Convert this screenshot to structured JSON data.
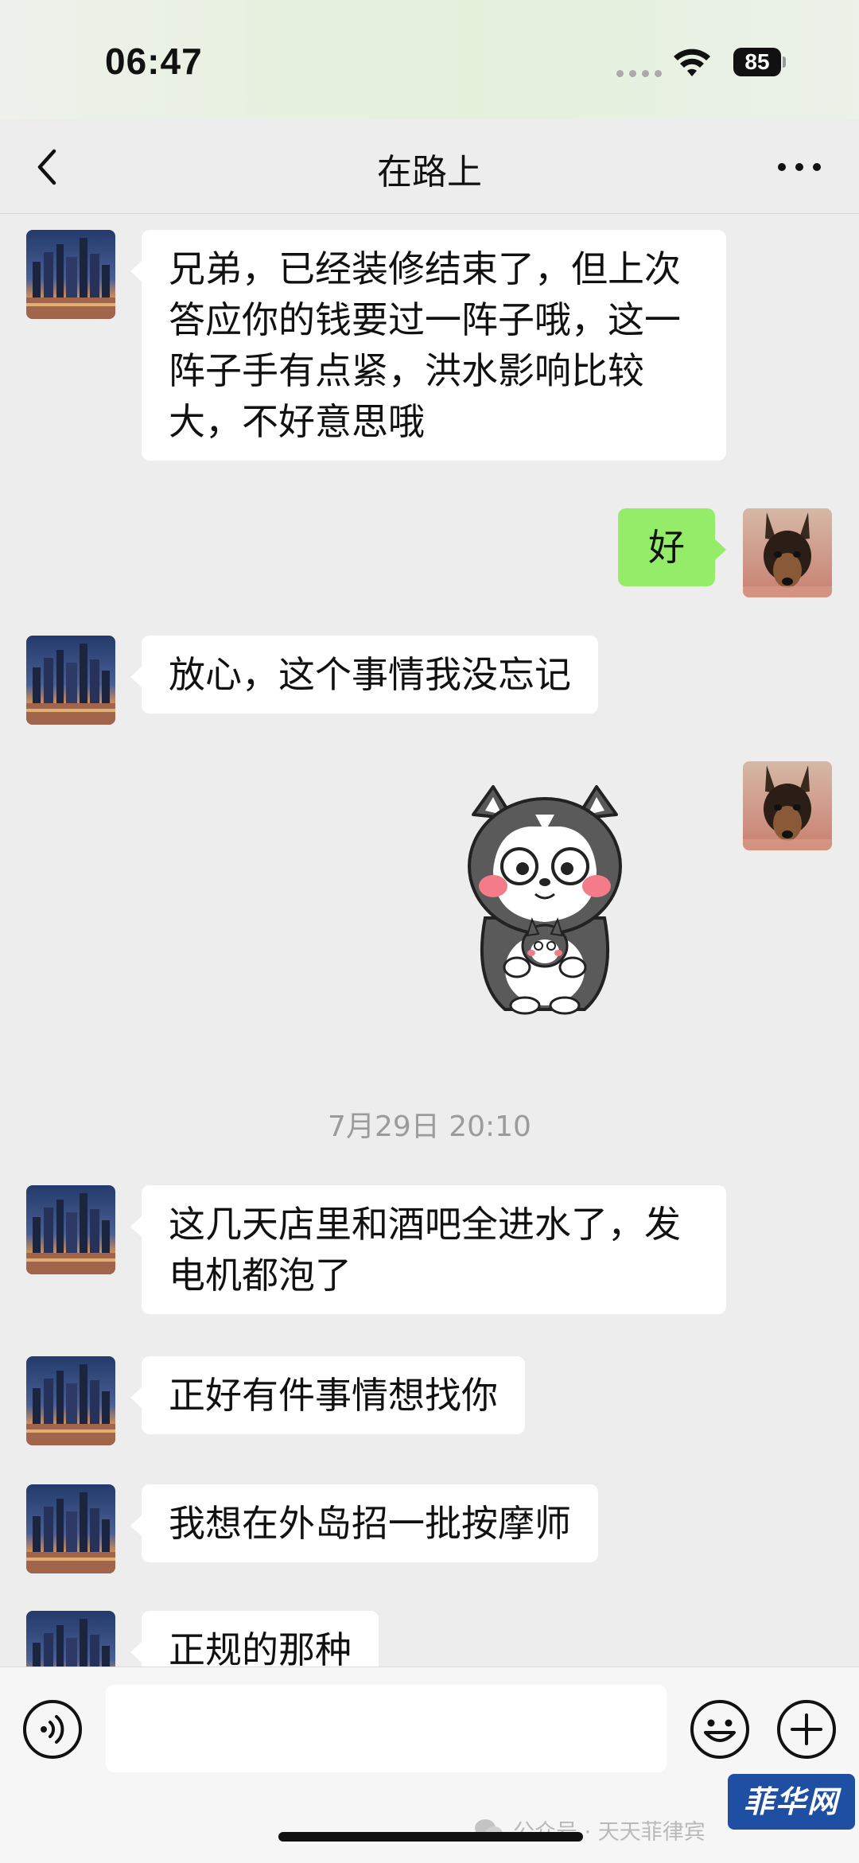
{
  "status_bar": {
    "time": "06:47",
    "battery": "85"
  },
  "header": {
    "title": "在路上"
  },
  "messages": [
    {
      "side": "left",
      "text": "兄弟，已经装修结束了，但上次答应你的钱要过一阵子哦，这一阵子手有点紧，洪水影响比较大，不好意思哦"
    },
    {
      "side": "right",
      "text": "好"
    },
    {
      "side": "left",
      "text": "放心，这个事情我没忘记"
    },
    {
      "side": "right",
      "type": "sticker",
      "sticker": "husky-sticker"
    },
    {
      "type": "timestamp",
      "text": "7月29日 20:10"
    },
    {
      "side": "left",
      "text": "这几天店里和酒吧全进水了，发电机都泡了"
    },
    {
      "side": "left",
      "text": "正好有件事情想找你"
    },
    {
      "side": "left",
      "text": "我想在外岛招一批按摩师"
    },
    {
      "side": "left",
      "text": "正规的那种"
    }
  ],
  "input_bar": {
    "placeholder": "",
    "voice_icon": "voice-icon",
    "emoji_icon": "smiley-icon",
    "plus_icon": "plus-icon"
  },
  "watermark": {
    "text": "公众号 · 天天菲律宾"
  },
  "logo": {
    "text": "菲华网"
  },
  "colors": {
    "background": "#ededed",
    "bubble_incoming": "#ffffff",
    "bubble_outgoing": "#95ec69",
    "logo_bg": "#1f4fa3"
  }
}
